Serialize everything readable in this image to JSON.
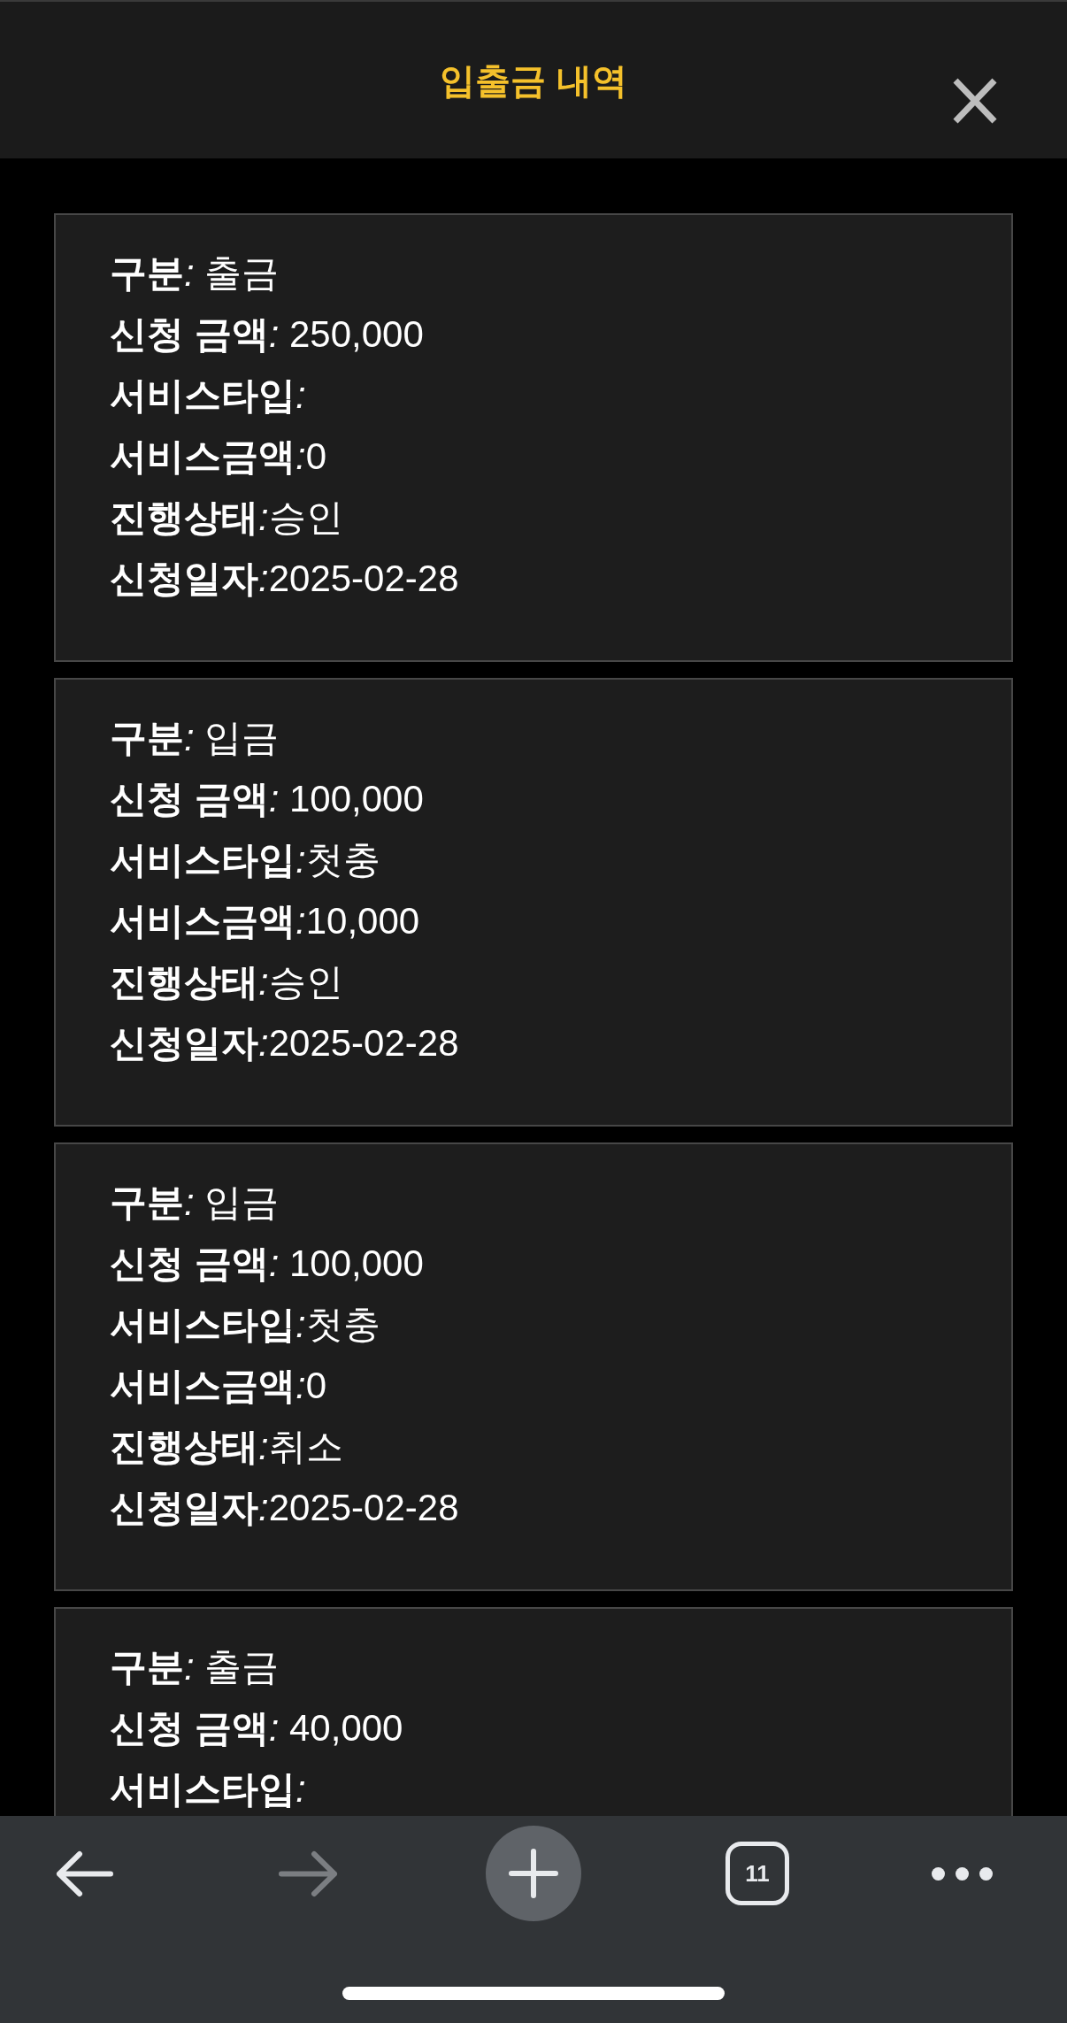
{
  "header": {
    "title": "입출금 내역"
  },
  "records": [
    {
      "fields": [
        {
          "label": "구분",
          "separator": ": ",
          "value": "출금"
        },
        {
          "label": "신청 금액",
          "separator": ": ",
          "value": "250,000"
        },
        {
          "label": "서비스타입",
          "separator": ":"
        },
        {
          "label": "서비스금액",
          "separator": ":",
          "value": "0"
        },
        {
          "label": "진행상태",
          "separator": ":",
          "value": "승인"
        },
        {
          "label": "신청일자",
          "separator": ":",
          "value": "2025-02-28"
        }
      ]
    },
    {
      "fields": [
        {
          "label": "구분",
          "separator": ": ",
          "value": "입금"
        },
        {
          "label": "신청 금액",
          "separator": ": ",
          "value": "100,000"
        },
        {
          "label": "서비스타입",
          "separator": ":",
          "value": "첫충"
        },
        {
          "label": "서비스금액",
          "separator": ":",
          "value": "10,000"
        },
        {
          "label": "진행상태",
          "separator": ":",
          "value": "승인"
        },
        {
          "label": "신청일자",
          "separator": ":",
          "value": "2025-02-28"
        }
      ]
    },
    {
      "fields": [
        {
          "label": "구분",
          "separator": ": ",
          "value": "입금"
        },
        {
          "label": "신청 금액",
          "separator": ": ",
          "value": "100,000"
        },
        {
          "label": "서비스타입",
          "separator": ":",
          "value": "첫충"
        },
        {
          "label": "서비스금액",
          "separator": ":",
          "value": "0"
        },
        {
          "label": "진행상태",
          "separator": ":",
          "value": "취소"
        },
        {
          "label": "신청일자",
          "separator": ":",
          "value": "2025-02-28"
        }
      ]
    },
    {
      "fields": [
        {
          "label": "구분",
          "separator": ": ",
          "value": "출금"
        },
        {
          "label": "신청 금액",
          "separator": ": ",
          "value": "40,000"
        },
        {
          "label": "서비스타입",
          "separator": ":"
        }
      ]
    }
  ],
  "toolbar": {
    "items": [
      {
        "kind": "back",
        "disabled": false
      },
      {
        "kind": "forward",
        "disabled": true
      },
      {
        "kind": "new_tab",
        "disabled": false
      },
      {
        "kind": "tabs",
        "label": "11",
        "disabled": false
      },
      {
        "kind": "more",
        "disabled": false
      }
    ]
  }
}
